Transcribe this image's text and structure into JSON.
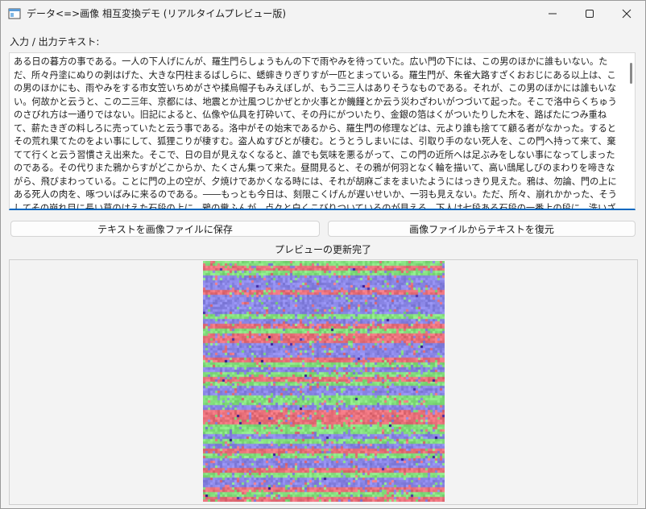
{
  "window": {
    "title": "データ<=>画像 相互変換デモ (リアルタイムプレビュー版)"
  },
  "icons": {
    "app": "app-window-icon",
    "minimize": "minimize-icon",
    "maximize": "maximize-icon",
    "close": "close-icon"
  },
  "io": {
    "label": "入力 / 出力テキスト:",
    "text": "ある日の暮方の事である。一人の下人げにんが、羅生門らしょうもんの下で雨やみを待っていた。広い門の下には、この男のほかに誰もいない。ただ、所々丹塗にぬりの剥はげた、大きな円柱まるばしらに、蟋蟀きりぎりすが一匹とまっている。羅生門が、朱雀大路すざくおおじにある以上は、この男のほかにも、雨やみをする市女笠いちめがさや揉烏帽子もみえぼしが、もう二三人はありそうなものである。それが、この男のほかには誰もいない。何故かと云うと、この二三年、京都には、地震とか辻風つじかぜとか火事とか饑饉とか云う災わざわいがつづいて起った。そこで洛中らくちゅうのさびれ方は一通りではない。旧記によると、仏像や仏具を打砕いて、その丹にがついたり、金銀の箔はくがついたりした木を、路ばたにつみ重ねて、薪たきぎの料しろに売っていたと云う事である。洛中がその始末であるから、羅生門の修理などは、元より誰も捨てて顧る者がなかった。するとその荒れ果てたのをよい事にして、狐狸こりが棲すむ。盗人ぬすびとが棲む。とうとうしまいには、引取り手のない死人を、この門へ持って来て、棄てて行くと云う習慣さえ出来た。そこで、日の目が見えなくなると、誰でも気味を悪るがって、この門の近所へは足ぶみをしない事になってしまったのである。その代りまた鴉からすがどこからか、たくさん集って来た。昼間見ると、その鴉が何羽となく輪を描いて、高い鴟尾しびのまわりを啼きながら、飛びまわっている。ことに門の上の空が、夕焼けであかくなる時には、それが胡麻ごまをまいたようにはっきり見えた。鴉は、勿論、門の上にある死人の肉を、啄ついばみに来るのである。――もっとも今日は、刻限こくげんが遅いせいか、一羽も見えない。ただ、所々、崩れかかった、そうしてその崩れ目に長い草のはえた石段の上に、鴉の糞ふんが、点々と白くこびりついているのが見える。下人は七段ある石段の一番上の段に、洗いざらした紺の襖あおの尻を据えて、右の頬に出来た、大きな面皰にきびを気にしながら、ぼんやり、雨のふるのを眺めていた。作者はさっき、「下人が雨やみを待っていた」と書いた。しかし、下人は雨がやんでも、格別どうしようと云う当てはな"
  },
  "buttons": {
    "save": "テキストを画像ファイルに保存",
    "restore": "画像ファイルからテキストを復元"
  },
  "status": "プレビューの更新完了",
  "preview": {
    "colors": {
      "red": "#e8707a",
      "green": "#84e07e",
      "blue": "#8a86e6",
      "dark": "#3c1f9a"
    }
  }
}
